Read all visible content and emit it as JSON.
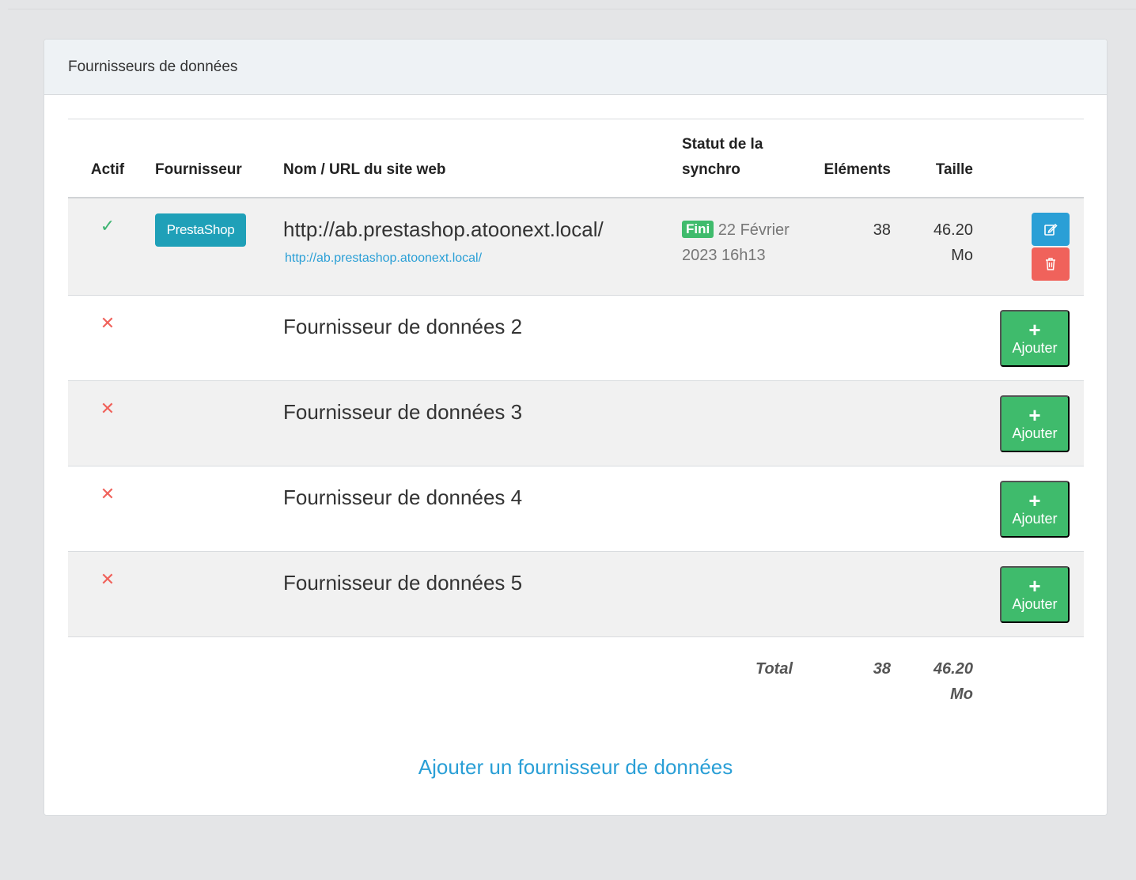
{
  "card": {
    "title": "Fournisseurs de données"
  },
  "table": {
    "headers": {
      "actif": "Actif",
      "fournisseur": "Fournisseur",
      "nom": "Nom / URL du site web",
      "statut_line1": "Statut de la",
      "statut_line2": "synchro",
      "elements": "Eléments",
      "taille": "Taille"
    },
    "rows": [
      {
        "active": true,
        "active_icon": "check-icon",
        "provider": "PrestaShop",
        "name": "http://ab.prestashop.atoonext.local/",
        "url": "http://ab.prestashop.atoonext.local/",
        "status_badge": "Fini",
        "status_date_line1": "22 Février",
        "status_date_line2": "2023 16h13",
        "elements": "38",
        "size_line1": "46.20",
        "size_line2": "Mo",
        "actions": [
          "edit-icon",
          "trash-icon"
        ]
      },
      {
        "active": false,
        "active_icon": "cross-icon",
        "name": "Fournisseur de données 2",
        "add_label": "Ajouter"
      },
      {
        "active": false,
        "active_icon": "cross-icon",
        "name": "Fournisseur de données 3",
        "add_label": "Ajouter"
      },
      {
        "active": false,
        "active_icon": "cross-icon",
        "name": "Fournisseur de données 4",
        "add_label": "Ajouter"
      },
      {
        "active": false,
        "active_icon": "cross-icon",
        "name": "Fournisseur de données 5",
        "add_label": "Ajouter"
      }
    ],
    "footer": {
      "total_label": "Total",
      "total_elements": "38",
      "total_size_line1": "46.20",
      "total_size_line2": "Mo"
    }
  },
  "add_provider_link": "Ajouter un fournisseur de données",
  "colors": {
    "primary": "#2a9fd6",
    "success": "#3fbb6c",
    "danger": "#f0625b",
    "prestashop": "#1fa0b8"
  }
}
